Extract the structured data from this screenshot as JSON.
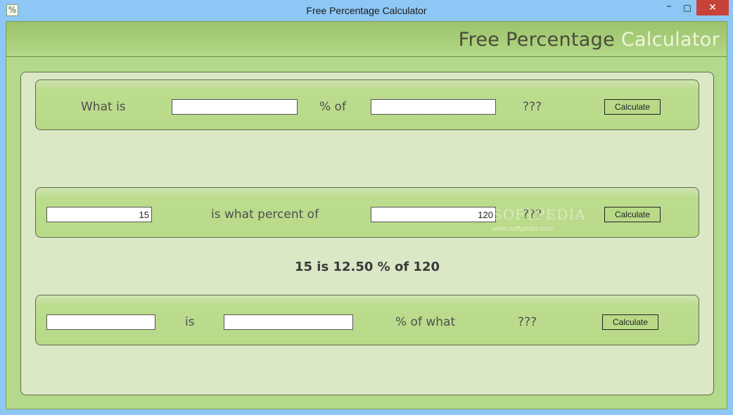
{
  "window": {
    "title": "Free Percentage Calculator",
    "icon_glyph": "%",
    "controls": {
      "minimize": "–",
      "maximize": "□",
      "close": "✕"
    }
  },
  "brand": {
    "part1": "Free Percentage",
    "part2": "Calculator"
  },
  "rows": [
    {
      "label_a": "What is",
      "input_a": "",
      "label_b": "% of",
      "input_b": "",
      "result_placeholder": "???",
      "button": "Calculate"
    },
    {
      "input_a": "15",
      "label_a": "is what percent of",
      "input_b": "120",
      "result_placeholder": "???",
      "button": "Calculate"
    },
    {
      "input_a": "",
      "label_a": "is",
      "input_b": "",
      "label_b": "% of what",
      "result_placeholder": "???",
      "button": "Calculate"
    }
  ],
  "result_text": "15 is 12.50 % of 120",
  "watermark": {
    "main": "SOFTPEDIA",
    "sub": "www.softpedia.com"
  },
  "colors": {
    "titlebar": "#8ec7f5",
    "header": "#a9cf7b",
    "panel": "#dbe8c6",
    "row": "#b8da88",
    "close": "#c7433a"
  }
}
